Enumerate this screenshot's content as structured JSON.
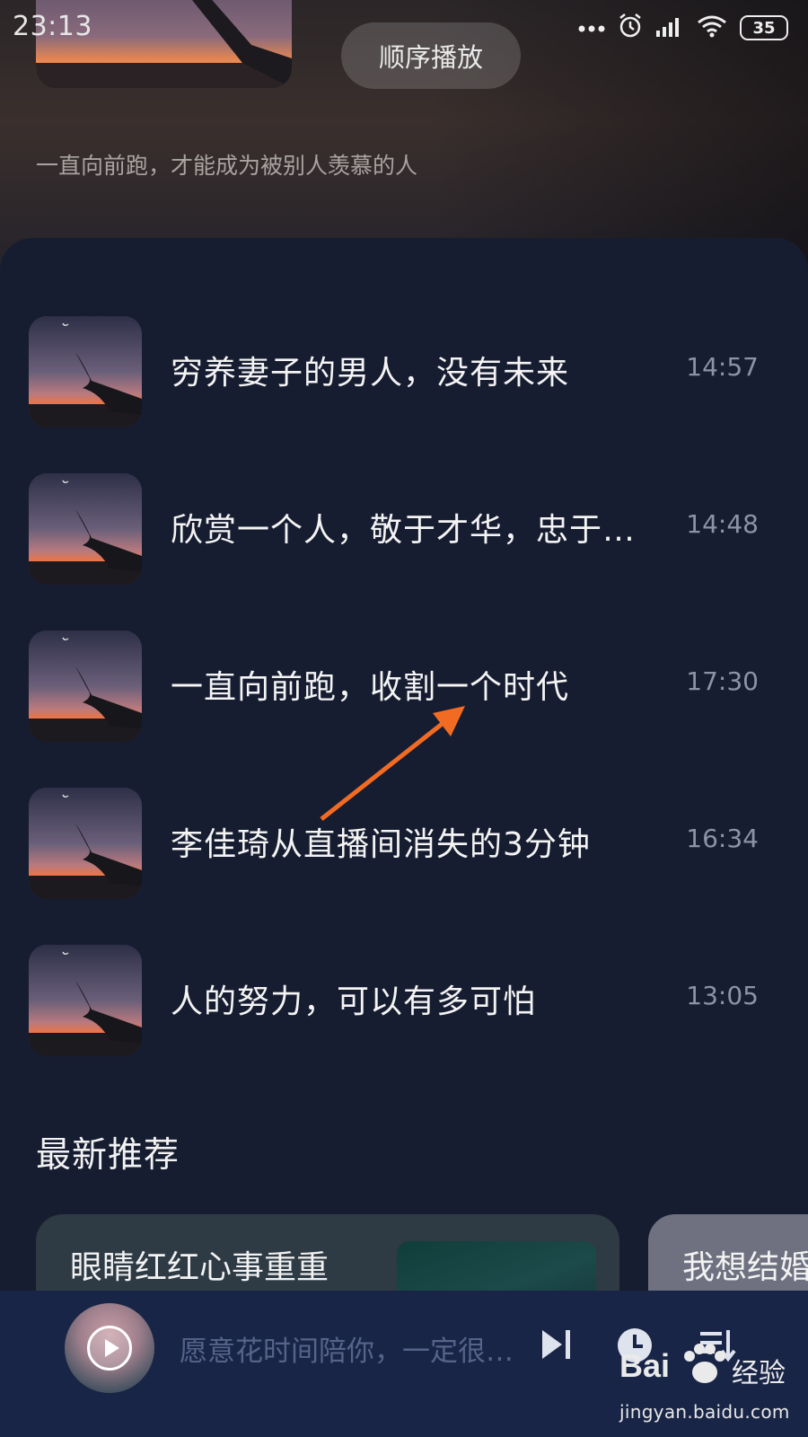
{
  "status_bar": {
    "time": "23:13",
    "battery": "35",
    "icons": [
      "more-dots-icon",
      "alarm-icon",
      "signal-icon",
      "wifi-icon",
      "battery-icon"
    ]
  },
  "header": {
    "play_order_label": "顺序播放",
    "description": "一直向前跑，才能成为被别人羡慕的人"
  },
  "episodes": [
    {
      "title": "穷养妻子的男人，没有未来",
      "duration": "14:57"
    },
    {
      "title": "欣赏一个人，敬于才华，忠于…",
      "duration": "14:48"
    },
    {
      "title": "一直向前跑，收割一个时代",
      "duration": "17:30"
    },
    {
      "title": "李佳琦从直播间消失的3分钟",
      "duration": "16:34"
    },
    {
      "title": "人的努力，可以有多可怕",
      "duration": "13:05"
    }
  ],
  "recommendations": {
    "section_title": "最新推荐",
    "cards": [
      {
        "title": "眼睛红红心事重重"
      },
      {
        "title": "我想结婚"
      }
    ]
  },
  "player": {
    "now_playing": "愿意花时间陪你，一定很…",
    "icons": [
      "play-icon",
      "next-track-icon",
      "timer-icon",
      "playlist-icon"
    ]
  },
  "watermark": {
    "logo": "Bai",
    "logo_suffix": "经验",
    "url": "jingyan.baidu.com"
  },
  "colors": {
    "panel_bg": "#171d31",
    "player_bg": "#192547",
    "annotation_arrow": "#f26b22"
  }
}
